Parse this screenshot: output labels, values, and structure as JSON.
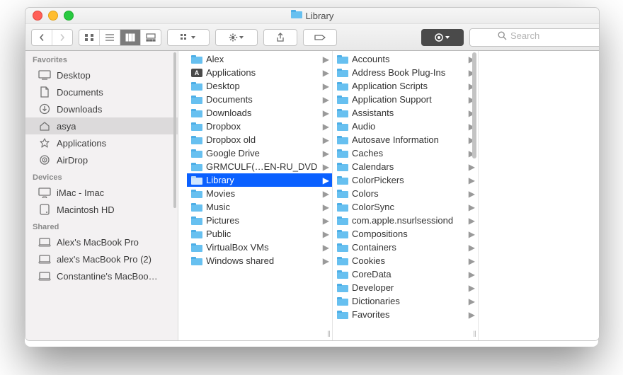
{
  "window": {
    "title": "Library"
  },
  "toolbar": {
    "search_placeholder": "Search",
    "active_view": "column"
  },
  "sidebar": {
    "groups": [
      {
        "label": "Favorites",
        "items": [
          {
            "icon": "desktop",
            "label": "Desktop",
            "selected": false
          },
          {
            "icon": "documents",
            "label": "Documents",
            "selected": false
          },
          {
            "icon": "downloads",
            "label": "Downloads",
            "selected": false
          },
          {
            "icon": "home",
            "label": "asya",
            "selected": true
          },
          {
            "icon": "applications",
            "label": "Applications",
            "selected": false
          },
          {
            "icon": "airdrop",
            "label": "AirDrop",
            "selected": false
          }
        ]
      },
      {
        "label": "Devices",
        "items": [
          {
            "icon": "imac",
            "label": "iMac - Imac",
            "selected": false
          },
          {
            "icon": "disk",
            "label": "Macintosh HD",
            "selected": false
          }
        ]
      },
      {
        "label": "Shared",
        "items": [
          {
            "icon": "remote",
            "label": "Alex's MacBook Pro",
            "selected": false
          },
          {
            "icon": "remote",
            "label": "alex's MacBook Pro (2)",
            "selected": false
          },
          {
            "icon": "remote",
            "label": "Constantine's MacBoo…",
            "selected": false
          }
        ]
      }
    ]
  },
  "columns": [
    {
      "items": [
        {
          "label": "Alex",
          "kind": "folder",
          "arrow": true,
          "selected": false
        },
        {
          "label": "Applications",
          "kind": "app",
          "arrow": true,
          "selected": false
        },
        {
          "label": "Desktop",
          "kind": "folder",
          "arrow": true,
          "selected": false
        },
        {
          "label": "Documents",
          "kind": "folder",
          "arrow": true,
          "selected": false
        },
        {
          "label": "Downloads",
          "kind": "folder",
          "arrow": true,
          "selected": false
        },
        {
          "label": "Dropbox",
          "kind": "folder",
          "arrow": true,
          "selected": false
        },
        {
          "label": "Dropbox old",
          "kind": "folder",
          "arrow": true,
          "selected": false
        },
        {
          "label": "Google Drive",
          "kind": "folder",
          "arrow": true,
          "selected": false
        },
        {
          "label": "GRMCULF(…EN-RU_DVD",
          "kind": "folder",
          "arrow": true,
          "selected": false
        },
        {
          "label": "Library",
          "kind": "folder",
          "arrow": true,
          "selected": true
        },
        {
          "label": "Movies",
          "kind": "folder",
          "arrow": true,
          "selected": false
        },
        {
          "label": "Music",
          "kind": "folder",
          "arrow": true,
          "selected": false
        },
        {
          "label": "Pictures",
          "kind": "folder",
          "arrow": true,
          "selected": false
        },
        {
          "label": "Public",
          "kind": "folder",
          "arrow": true,
          "selected": false
        },
        {
          "label": "VirtualBox VMs",
          "kind": "folder",
          "arrow": true,
          "selected": false
        },
        {
          "label": "Windows shared",
          "kind": "folder",
          "arrow": true,
          "selected": false
        }
      ]
    },
    {
      "items": [
        {
          "label": "Accounts",
          "kind": "folder",
          "arrow": true
        },
        {
          "label": "Address Book Plug-Ins",
          "kind": "folder",
          "arrow": true
        },
        {
          "label": "Application Scripts",
          "kind": "folder",
          "arrow": true
        },
        {
          "label": "Application Support",
          "kind": "folder",
          "arrow": true
        },
        {
          "label": "Assistants",
          "kind": "folder",
          "arrow": true
        },
        {
          "label": "Audio",
          "kind": "folder",
          "arrow": true
        },
        {
          "label": "Autosave Information",
          "kind": "folder",
          "arrow": true
        },
        {
          "label": "Caches",
          "kind": "folder",
          "arrow": true
        },
        {
          "label": "Calendars",
          "kind": "folder",
          "arrow": true
        },
        {
          "label": "ColorPickers",
          "kind": "folder",
          "arrow": true
        },
        {
          "label": "Colors",
          "kind": "folder",
          "arrow": true
        },
        {
          "label": "ColorSync",
          "kind": "folder",
          "arrow": true
        },
        {
          "label": "com.apple.nsurlsessiond",
          "kind": "folder",
          "arrow": true
        },
        {
          "label": "Compositions",
          "kind": "folder",
          "arrow": true
        },
        {
          "label": "Containers",
          "kind": "folder",
          "arrow": true
        },
        {
          "label": "Cookies",
          "kind": "folder",
          "arrow": true
        },
        {
          "label": "CoreData",
          "kind": "folder",
          "arrow": true
        },
        {
          "label": "Developer",
          "kind": "folder",
          "arrow": true
        },
        {
          "label": "Dictionaries",
          "kind": "folder",
          "arrow": true
        },
        {
          "label": "Favorites",
          "kind": "folder",
          "arrow": true
        }
      ]
    }
  ]
}
